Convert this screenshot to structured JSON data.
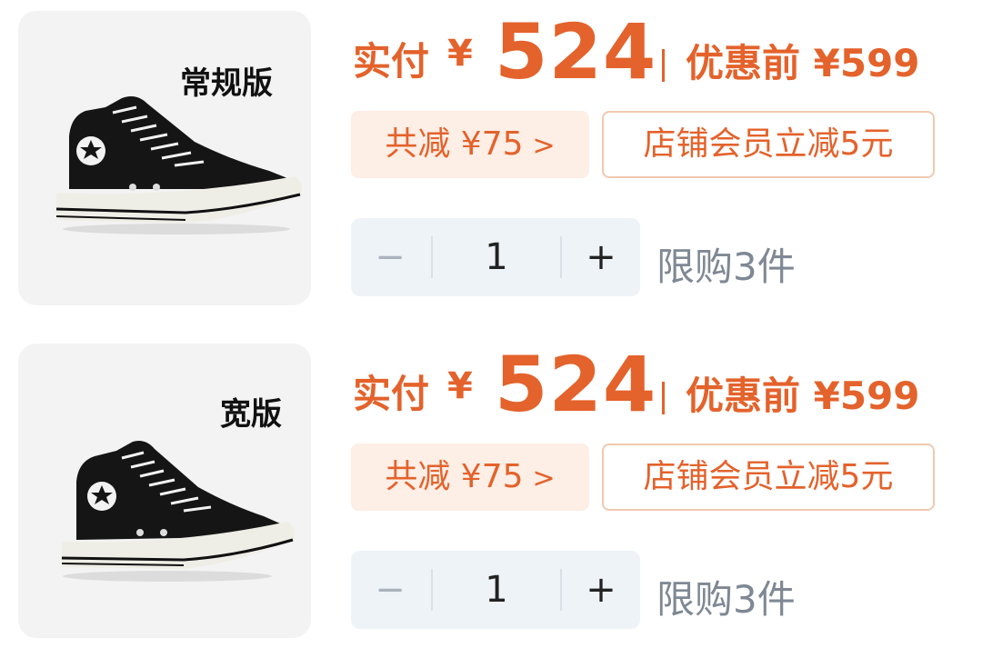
{
  "products": [
    {
      "variant": "常规版",
      "pay_label": "实付",
      "currency": "¥",
      "pay_amount": "524",
      "original_text": "优惠前 ¥599",
      "discount_text": "共减 ¥75",
      "discount_chevron": ">",
      "member_text": "店铺会员立减5元",
      "minus": "−",
      "quantity": "1",
      "plus": "+",
      "limit_text": "限购3件",
      "shoe_type": "high-top sneaker"
    },
    {
      "variant": "宽版",
      "pay_label": "实付",
      "currency": "¥",
      "pay_amount": "524",
      "original_text": "优惠前 ¥599",
      "discount_text": "共减 ¥75",
      "discount_chevron": ">",
      "member_text": "店铺会员立减5元",
      "minus": "−",
      "quantity": "1",
      "plus": "+",
      "limit_text": "限购3件",
      "shoe_type": "high-top sneaker"
    }
  ],
  "colors": {
    "accent": "#e4622b",
    "tag_bg": "#fdeee6",
    "stepper_bg": "#eef3f8",
    "muted": "#7f8894"
  }
}
